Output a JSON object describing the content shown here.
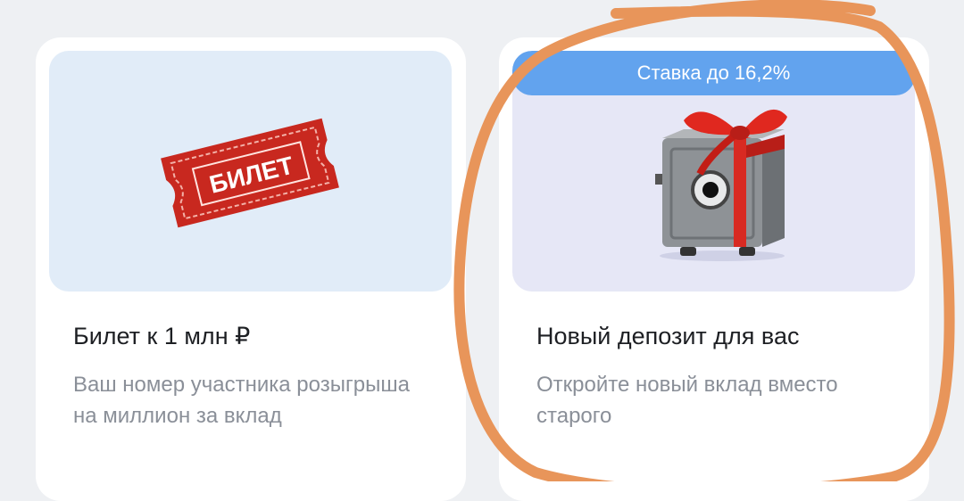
{
  "cards": [
    {
      "title": "Билет к 1 млн ₽",
      "description": "Ваш номер участника розыгрыша на миллион за вклад",
      "ticket_label": "БИЛЕТ",
      "icon": "ticket-icon"
    },
    {
      "badge": "Ставка до 16,2%",
      "title": "Новый депозит для вас",
      "description": "Откройте новый вклад вместо старого",
      "icon": "gift-safe-icon"
    }
  ],
  "colors": {
    "badge": "#62a3ee",
    "highlight_stroke": "#e8955a",
    "ticket": "#c8281f"
  }
}
